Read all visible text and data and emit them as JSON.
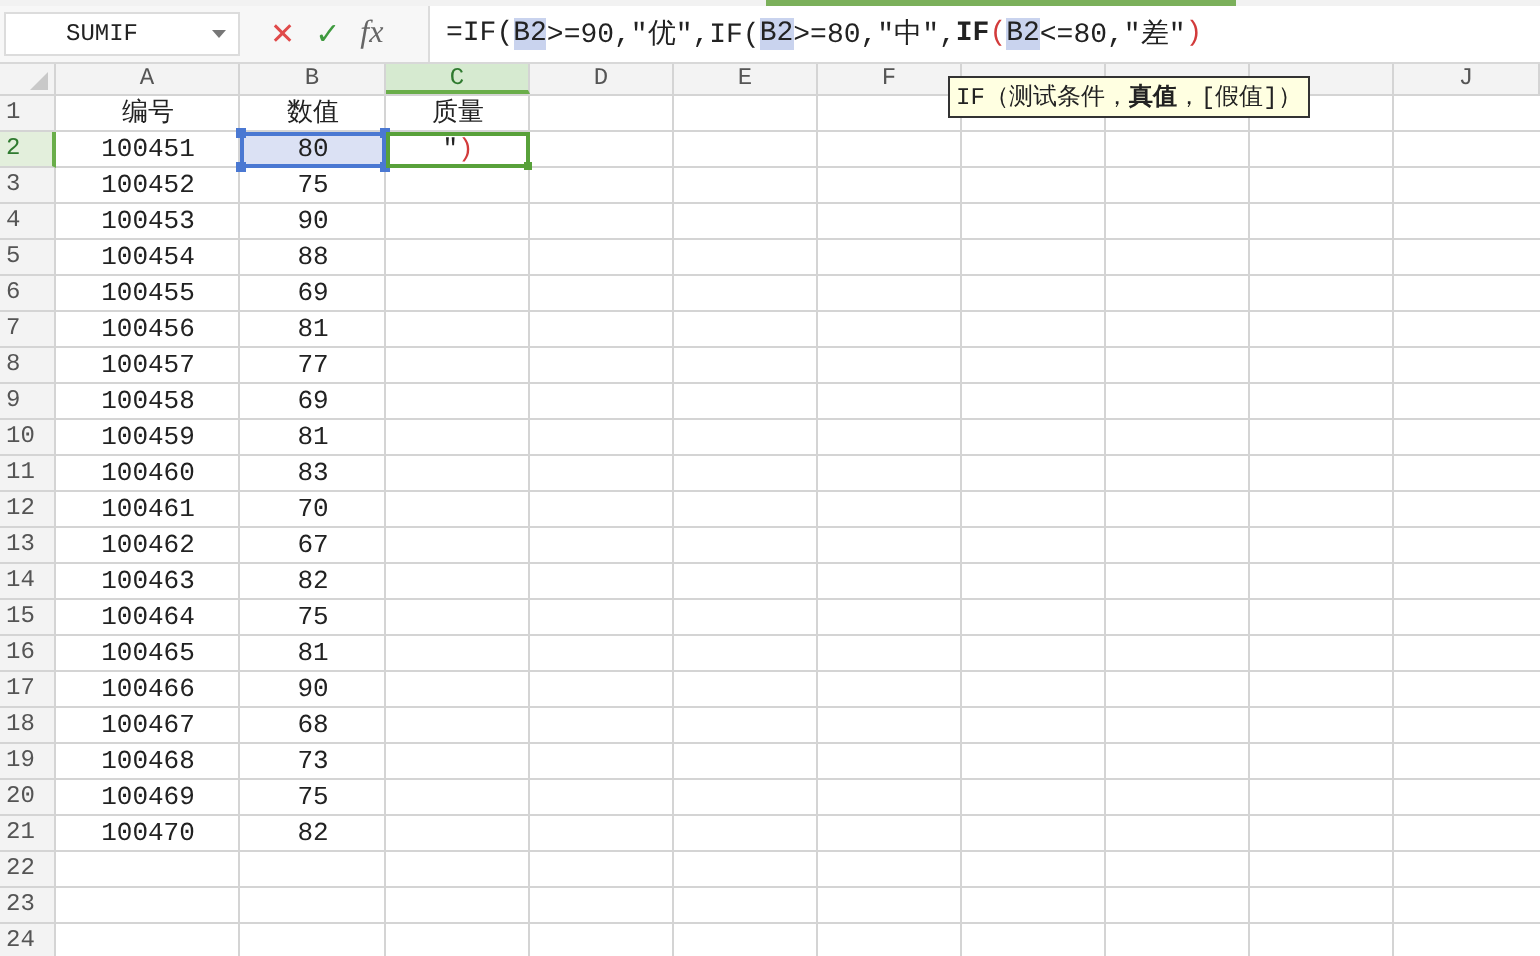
{
  "name_box": {
    "value": "SUMIF"
  },
  "formula_bar": {
    "cancel": "✕",
    "confirm": "✓",
    "function": "fx",
    "segments": [
      {
        "kind": "plain",
        "text": "=IF("
      },
      {
        "kind": "ref",
        "text": "B2"
      },
      {
        "kind": "plain",
        "text": ">=90,\"优\",IF("
      },
      {
        "kind": "ref",
        "text": "B2"
      },
      {
        "kind": "plain",
        "text": ">=80,\"中\","
      },
      {
        "kind": "bold",
        "text": "IF"
      },
      {
        "kind": "paren",
        "text": "("
      },
      {
        "kind": "ref",
        "text": "B2"
      },
      {
        "kind": "plain",
        "text": "<=80,\"差\""
      },
      {
        "kind": "paren",
        "text": ")"
      }
    ]
  },
  "tooltip": {
    "text": "IF（测试条件，**真值**，[假值]）"
  },
  "columns": [
    {
      "label": "A",
      "selected": false
    },
    {
      "label": "B",
      "selected": false
    },
    {
      "label": "C",
      "selected": true
    },
    {
      "label": "D",
      "selected": false
    },
    {
      "label": "E",
      "selected": false
    },
    {
      "label": "F",
      "selected": false
    },
    {
      "selected": false
    },
    {
      "selected": false
    },
    {
      "selected": false
    },
    {
      "label": "J",
      "selected": false
    }
  ],
  "rows": [
    {
      "num": "1",
      "selected": false,
      "cells": [
        {
          "text": "编号"
        },
        {
          "text": "数值"
        },
        {
          "text": "质量"
        }
      ]
    },
    {
      "num": "2",
      "selected": true,
      "cells": [
        {
          "text": "100451",
          "selected": false,
          "editing": false
        },
        {
          "text": "80",
          "selected": true,
          "editing": false
        },
        {
          "selected": false,
          "editing": true,
          "segments": [
            {
              "kind": "plain",
              "text": "\""
            },
            {
              "kind": "paren",
              "text": ")"
            }
          ]
        }
      ]
    },
    {
      "num": "3",
      "selected": false,
      "cells": [
        {
          "text": "100452"
        },
        {
          "text": "75"
        }
      ]
    },
    {
      "num": "4",
      "selected": false,
      "cells": [
        {
          "text": "100453"
        },
        {
          "text": "90"
        }
      ]
    },
    {
      "num": "5",
      "selected": false,
      "cells": [
        {
          "text": "100454"
        },
        {
          "text": "88"
        }
      ]
    },
    {
      "num": "6",
      "selected": false,
      "cells": [
        {
          "text": "100455"
        },
        {
          "text": "69"
        }
      ]
    },
    {
      "num": "7",
      "selected": false,
      "cells": [
        {
          "text": "100456"
        },
        {
          "text": "81"
        }
      ]
    },
    {
      "num": "8",
      "selected": false,
      "cells": [
        {
          "text": "100457"
        },
        {
          "text": "77"
        }
      ]
    },
    {
      "num": "9",
      "selected": false,
      "cells": [
        {
          "text": "100458"
        },
        {
          "text": "69"
        }
      ]
    },
    {
      "num": "10",
      "selected": false,
      "cells": [
        {
          "text": "100459"
        },
        {
          "text": "81"
        }
      ]
    },
    {
      "num": "11",
      "selected": false,
      "cells": [
        {
          "text": "100460"
        },
        {
          "text": "83"
        }
      ]
    },
    {
      "num": "12",
      "selected": false,
      "cells": [
        {
          "text": "100461"
        },
        {
          "text": "70"
        }
      ]
    },
    {
      "num": "13",
      "selected": false,
      "cells": [
        {
          "text": "100462"
        },
        {
          "text": "67"
        }
      ]
    },
    {
      "num": "14",
      "selected": false,
      "cells": [
        {
          "text": "100463"
        },
        {
          "text": "82"
        }
      ]
    },
    {
      "num": "15",
      "selected": false,
      "cells": [
        {
          "text": "100464"
        },
        {
          "text": "75"
        }
      ]
    },
    {
      "num": "16",
      "selected": false,
      "cells": [
        {
          "text": "100465"
        },
        {
          "text": "81"
        }
      ]
    },
    {
      "num": "17",
      "selected": false,
      "cells": [
        {
          "text": "100466"
        },
        {
          "text": "90"
        }
      ]
    },
    {
      "num": "18",
      "selected": false,
      "cells": [
        {
          "text": "100467"
        },
        {
          "text": "68"
        }
      ]
    },
    {
      "num": "19",
      "selected": false,
      "cells": [
        {
          "text": "100468"
        },
        {
          "text": "73"
        }
      ]
    },
    {
      "num": "20",
      "selected": false,
      "cells": [
        {
          "text": "100469"
        },
        {
          "text": "75"
        }
      ]
    },
    {
      "num": "21",
      "selected": false,
      "cells": [
        {
          "text": "100470"
        },
        {
          "text": "82"
        }
      ]
    },
    {
      "num": "22",
      "selected": false,
      "cells": []
    },
    {
      "num": "23",
      "selected": false,
      "cells": []
    },
    {
      "num": "24",
      "selected": false,
      "cells": []
    }
  ]
}
